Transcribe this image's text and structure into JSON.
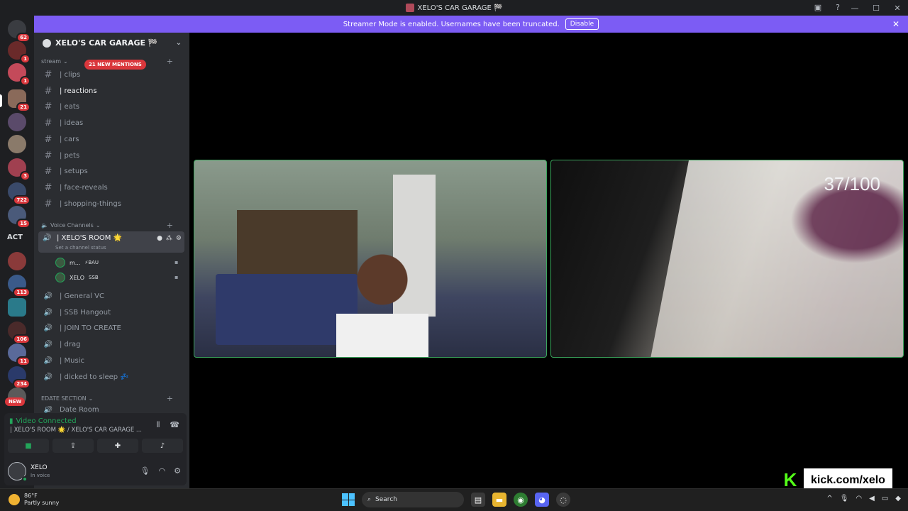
{
  "window": {
    "title": "XELO'S CAR GARAGE 🏁"
  },
  "banner": {
    "text": "Streamer Mode is enabled. Usernames have been truncated.",
    "button": "Disable"
  },
  "server_rail": {
    "badges": [
      "62",
      "1",
      "1",
      "21",
      "3",
      "722",
      "15",
      "113",
      "106",
      "11",
      "234"
    ],
    "act_label": "ACT",
    "new_label": "NEW"
  },
  "guild": {
    "name": "XELO'S CAR GARAGE 🏁",
    "mentions_pill": "21 NEW MENTIONS"
  },
  "categories": {
    "stream": "stream",
    "voice": "Voice Channels",
    "edate": "EDATE SECTION"
  },
  "text_channels": [
    {
      "label": "| clips",
      "active": false
    },
    {
      "label": "| reactions",
      "active": true
    },
    {
      "label": "| eats",
      "active": false
    },
    {
      "label": "| ideas",
      "active": false
    },
    {
      "label": "| cars",
      "active": false
    },
    {
      "label": "| pets",
      "active": false
    },
    {
      "label": "| setups",
      "active": false
    },
    {
      "label": "| face-reveals",
      "active": false
    },
    {
      "label": "| shopping-things",
      "active": false
    }
  ],
  "voice_room": {
    "name": "| XELO'S ROOM 🌟",
    "status": "Set a channel status",
    "users": [
      {
        "name": "m...",
        "tag": "⚡BAU"
      },
      {
        "name": "XELO",
        "tag": "SSB"
      }
    ]
  },
  "voice_channels": [
    "| General VC",
    "| SSB Hangout",
    "| JOIN TO CREATE",
    "| drag",
    "| Music",
    "| dicked to sleep 💤"
  ],
  "edate_first": "Date Room",
  "voice_panel": {
    "status": "Video Connected",
    "location": "| XELO'S ROOM 🌟 / XELO'S CAR GARAGE ..."
  },
  "user": {
    "name": "XELO",
    "status": "In voice"
  },
  "stream": {
    "counter": "37/100",
    "watermark_url": "kick.com/xelo",
    "watermark_logo": "K"
  },
  "taskbar": {
    "temp": "86°F",
    "weather": "Partly sunny",
    "search": "Search"
  },
  "colors": {
    "accent": "#7c5cf4",
    "online": "#23a55a",
    "mention": "#da373c",
    "kick": "#53fc18"
  }
}
